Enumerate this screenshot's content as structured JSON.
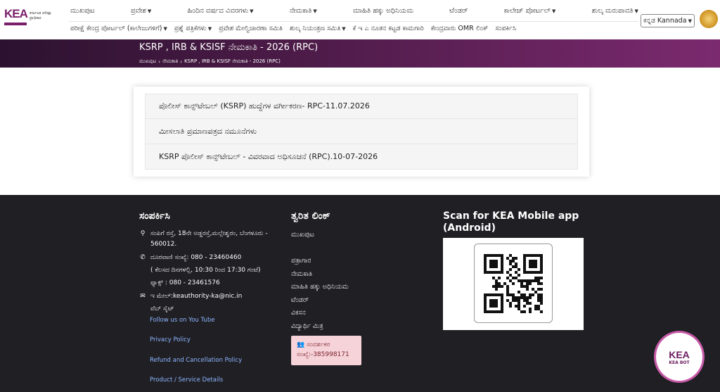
{
  "header": {
    "logo_text": "KEA",
    "logo_subtitle": "ಕರ್ನಾಟಕ ಪರೀಕ್ಷಾ ಪ್ರಾಧಿಕಾರ",
    "nav_row1": [
      {
        "label": "ಮುಖಪುಟ",
        "dropdown": false
      },
      {
        "label": "ಪ್ರವೇಶ",
        "dropdown": true
      },
      {
        "label": "ಹಿಂದಿನ ವರ್ಷದ ವಿವರಗಳು",
        "dropdown": true
      },
      {
        "label": "ನೇಮಕಾತಿ",
        "dropdown": true
      },
      {
        "label": "ಮಾಹಿತಿ ಹಕ್ಕು ಅಧಿನಿಯಮ",
        "dropdown": false
      },
      {
        "label": "ಟೆಂಡರ್",
        "dropdown": false
      },
      {
        "label": "ಕಾಲೇಜ್ ಪೋರ್ಟಲ್",
        "dropdown": true
      },
      {
        "label": "ಶುಲ್ಕ ಮರುಪಾವತಿ",
        "dropdown": true
      }
    ],
    "nav_row2": [
      {
        "label": "ಪರೀಕ್ಷೆ ಕೇಂದ್ರ ಪೋರ್ಟಲ್ (ಕಾಲೇಜುಗಳಿಗೆ)",
        "dropdown": true
      },
      {
        "label": "ಪ್ರಶ್ನೆ ಪತ್ರಿಕೆಗಳು",
        "dropdown": true
      },
      {
        "label": "ಪ್ರವೇಶ ಮೇಲ್ವಿಚಾರಣಾ ಸಮಿತಿ",
        "dropdown": false
      },
      {
        "label": "ಶುಲ್ಕ ನಿಯಂತ್ರಣ ಸಮಿತಿ",
        "dropdown": true
      },
      {
        "label": "ಕೆ ಇ ಎ ನೂತನ ಕಟ್ಟಡ ಕಾಮಗಾರಿ",
        "dropdown": false
      },
      {
        "label": "ಕೇಂದ್ರವಾರು OMR ಲಿಂಕ್",
        "dropdown": false
      },
      {
        "label": "ಸಂಪರ್ಕಿಸಿ",
        "dropdown": false
      }
    ],
    "language": "ಕನ್ನಡ Kannada"
  },
  "band": {
    "title": "KSRP , IRB & KSISF ನೇಮಕಾತಿ - 2026 (RPC)",
    "breadcrumb": [
      "ಮುಖಪುಟ",
      "ನೇಮಕಾತಿ",
      "KSRP , IRB & KSISF ನೇಮಕಾತಿ - 2026 (RPC)"
    ]
  },
  "list_items": [
    "ಪೊಲೀಸ್ ಕಾನ್ಸ್‌ಟೇಬಲ್ (KSRP) ಹುದ್ದೆಗಳ ವರ್ಗೀಕರಣ- RPC-11.07.2026",
    "ಮೀಸಲಾತಿ ಪ್ರಮಾಣಪತ್ರದ ನಮೂನೆಗಳು",
    "KSRP ಪೊಲೀಸ್ ಕಾನ್ಸ್‌ಟೇಬಲ್ - ವಿವರವಾದ ಅಧಿಸೂಚನೆ (RPC).10-07-2026"
  ],
  "footer": {
    "contact": {
      "heading": "ಸಂಪರ್ಕಿಸಿ",
      "address": "ಸಂಪಿಗೆ ರಸ್ತೆ, 18ನೇ ಅಡ್ಡರಸ್ತೆ,ಮಲ್ಲೇಶ್ವರಂ, ಬೆಂಗಳೂರು - 560012.",
      "phone": "ದೂರವಾಣಿ ಸಂಖ್ಯೆ: 080 - 23460460",
      "hours": "( ಕೆಲಸದ ದಿನಗಳಲ್ಲಿ, 10:30 ರಿಂದ 17:30 ಗಂಟೆ)",
      "fax": "ಫ್ಯಾಕ್ಸ್ : 080 - 23461576",
      "email": "ಇ ಮೇಲ್:keauthority-ka@nic.in",
      "website": "ವೆಬ್ ಸೈಟ್",
      "links": [
        "Follow us on You Tube",
        "Privacy Policy",
        "Refund and Cancellation Policy",
        "Product / Service Details"
      ]
    },
    "quick_links": {
      "heading": "ತ್ವರಿತ ಲಿಂಕ್",
      "items": [
        "ಮುಖಪುಟ",
        "",
        "ಪತ್ರಾಗಾರ",
        "ನೇಮಕಾತಿ",
        "ಮಾಹಿತಿ ಹಕ್ಕು ಅಧಿನಿಯಮ",
        "ಟೆಂಡರ್",
        "ವಿಕಸನ",
        "ವಿದ್ಯಾರ್ಥಿ ಮಿತ್ರ"
      ],
      "visitor_label": "ಸಂದರ್ಶಕರ",
      "visitor_count": "ಸಂಖ್ಯೆ:-385998171"
    },
    "app": {
      "heading": "Scan for KEA Mobile app (Android)"
    }
  },
  "kea_bot": {
    "label": "KEA BOT",
    "logo": "KEA"
  },
  "colors": {
    "band": "#4f1c4a",
    "footer": "#1f1f24",
    "link": "#8fb6ff",
    "visitor_bg": "#f6d3d9"
  }
}
